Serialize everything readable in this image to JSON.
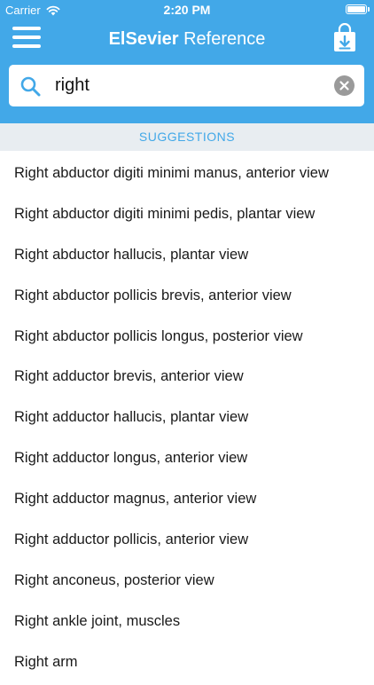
{
  "status_bar": {
    "carrier": "Carrier",
    "time": "2:20 PM"
  },
  "nav": {
    "title_bold": "ElSevier",
    "title_regular": " Reference"
  },
  "search": {
    "value": "right",
    "placeholder": ""
  },
  "suggestions_header": "SUGGESTIONS",
  "suggestions": [
    "Right abductor digiti minimi manus, anterior view",
    "Right abductor digiti minimi pedis, plantar view",
    "Right abductor hallucis, plantar view",
    "Right abductor pollicis brevis, anterior view",
    "Right abductor pollicis longus, posterior view",
    "Right adductor brevis, anterior view",
    "Right adductor hallucis, plantar view",
    "Right adductor longus, anterior view",
    "Right adductor magnus, anterior view",
    "Right adductor pollicis, anterior view",
    "Right anconeus, posterior view",
    "Right ankle joint, muscles",
    "Right arm"
  ],
  "colors": {
    "accent": "#42a8e8",
    "section_bg": "#e8edf1",
    "text": "#1a1a1a"
  },
  "icons": {
    "menu": "hamburger-icon",
    "download": "download-bag-icon",
    "search": "search-icon",
    "clear": "clear-icon",
    "wifi": "wifi-icon",
    "battery": "battery-icon"
  }
}
